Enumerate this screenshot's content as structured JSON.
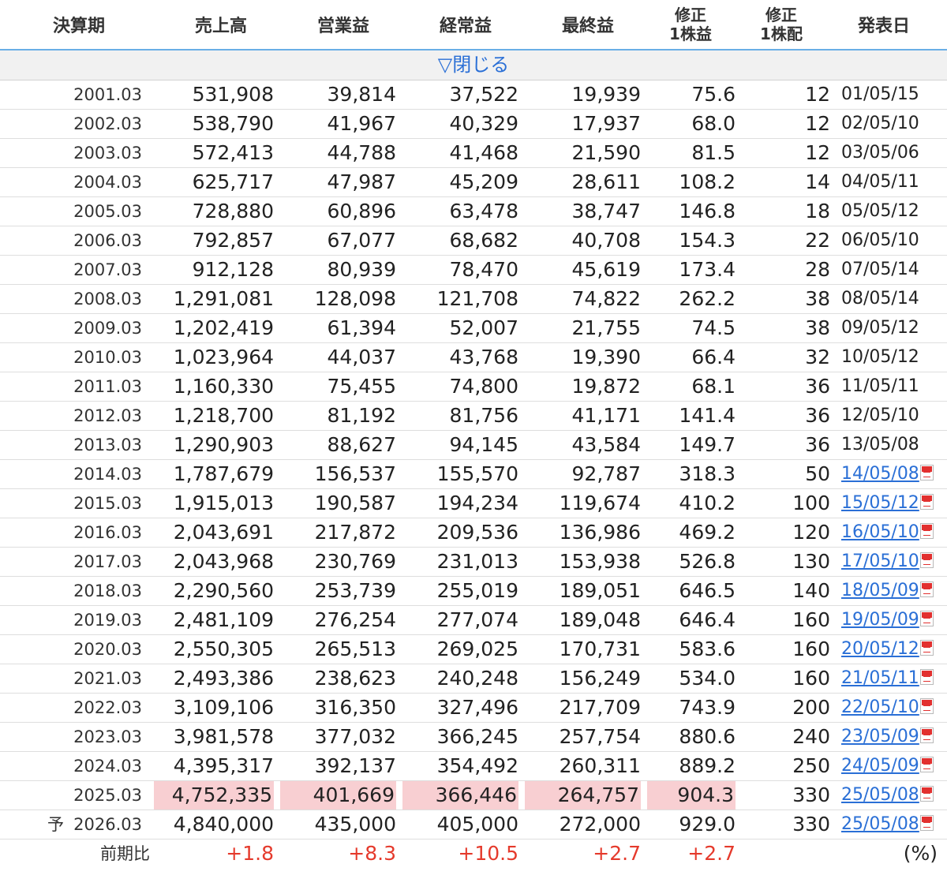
{
  "headers": {
    "period": "決算期",
    "sales": "売上高",
    "operating": "営業益",
    "ordinary": "経常益",
    "net": "最終益",
    "eps_line1": "修正",
    "eps_line2": "1株益",
    "dps_line1": "修正",
    "dps_line2": "1株配",
    "date": "発表日"
  },
  "toggle_label": "▽閉じる",
  "rows": [
    {
      "period": "2001.03",
      "sales": "531,908",
      "operating": "39,814",
      "ordinary": "37,522",
      "net": "19,939",
      "eps": "75.6",
      "dps": "12",
      "date": "01/05/15"
    },
    {
      "period": "2002.03",
      "sales": "538,790",
      "operating": "41,967",
      "ordinary": "40,329",
      "net": "17,937",
      "eps": "68.0",
      "dps": "12",
      "date": "02/05/10"
    },
    {
      "period": "2003.03",
      "sales": "572,413",
      "operating": "44,788",
      "ordinary": "41,468",
      "net": "21,590",
      "eps": "81.5",
      "dps": "12",
      "date": "03/05/06"
    },
    {
      "period": "2004.03",
      "sales": "625,717",
      "operating": "47,987",
      "ordinary": "45,209",
      "net": "28,611",
      "eps": "108.2",
      "dps": "14",
      "date": "04/05/11"
    },
    {
      "period": "2005.03",
      "sales": "728,880",
      "operating": "60,896",
      "ordinary": "63,478",
      "net": "38,747",
      "eps": "146.8",
      "dps": "18",
      "date": "05/05/12"
    },
    {
      "period": "2006.03",
      "sales": "792,857",
      "operating": "67,077",
      "ordinary": "68,682",
      "net": "40,708",
      "eps": "154.3",
      "dps": "22",
      "date": "06/05/10"
    },
    {
      "period": "2007.03",
      "sales": "912,128",
      "operating": "80,939",
      "ordinary": "78,470",
      "net": "45,619",
      "eps": "173.4",
      "dps": "28",
      "date": "07/05/14"
    },
    {
      "period": "2008.03",
      "sales": "1,291,081",
      "operating": "128,098",
      "ordinary": "121,708",
      "net": "74,822",
      "eps": "262.2",
      "dps": "38",
      "date": "08/05/14"
    },
    {
      "period": "2009.03",
      "sales": "1,202,419",
      "operating": "61,394",
      "ordinary": "52,007",
      "net": "21,755",
      "eps": "74.5",
      "dps": "38",
      "date": "09/05/12"
    },
    {
      "period": "2010.03",
      "sales": "1,023,964",
      "operating": "44,037",
      "ordinary": "43,768",
      "net": "19,390",
      "eps": "66.4",
      "dps": "32",
      "date": "10/05/12"
    },
    {
      "period": "2011.03",
      "sales": "1,160,330",
      "operating": "75,455",
      "ordinary": "74,800",
      "net": "19,872",
      "eps": "68.1",
      "dps": "36",
      "date": "11/05/11"
    },
    {
      "period": "2012.03",
      "sales": "1,218,700",
      "operating": "81,192",
      "ordinary": "81,756",
      "net": "41,171",
      "eps": "141.4",
      "dps": "36",
      "date": "12/05/10"
    },
    {
      "period": "2013.03",
      "sales": "1,290,903",
      "operating": "88,627",
      "ordinary": "94,145",
      "net": "43,584",
      "eps": "149.7",
      "dps": "36",
      "date": "13/05/08"
    },
    {
      "period": "2014.03",
      "sales": "1,787,679",
      "operating": "156,537",
      "ordinary": "155,570",
      "net": "92,787",
      "eps": "318.3",
      "dps": "50",
      "date": "14/05/08"
    },
    {
      "period": "2015.03",
      "sales": "1,915,013",
      "operating": "190,587",
      "ordinary": "194,234",
      "net": "119,674",
      "eps": "410.2",
      "dps": "100",
      "date": "15/05/12"
    },
    {
      "period": "2016.03",
      "sales": "2,043,691",
      "operating": "217,872",
      "ordinary": "209,536",
      "net": "136,986",
      "eps": "469.2",
      "dps": "120",
      "date": "16/05/10"
    },
    {
      "period": "2017.03",
      "sales": "2,043,968",
      "operating": "230,769",
      "ordinary": "231,013",
      "net": "153,938",
      "eps": "526.8",
      "dps": "130",
      "date": "17/05/10"
    },
    {
      "period": "2018.03",
      "sales": "2,290,560",
      "operating": "253,739",
      "ordinary": "255,019",
      "net": "189,051",
      "eps": "646.5",
      "dps": "140",
      "date": "18/05/09"
    },
    {
      "period": "2019.03",
      "sales": "2,481,109",
      "operating": "276,254",
      "ordinary": "277,074",
      "net": "189,048",
      "eps": "646.4",
      "dps": "160",
      "date": "19/05/09"
    },
    {
      "period": "2020.03",
      "sales": "2,550,305",
      "operating": "265,513",
      "ordinary": "269,025",
      "net": "170,731",
      "eps": "583.6",
      "dps": "160",
      "date": "20/05/12"
    },
    {
      "period": "2021.03",
      "sales": "2,493,386",
      "operating": "238,623",
      "ordinary": "240,248",
      "net": "156,249",
      "eps": "534.0",
      "dps": "160",
      "date": "21/05/11"
    },
    {
      "period": "2022.03",
      "sales": "3,109,106",
      "operating": "316,350",
      "ordinary": "327,496",
      "net": "217,709",
      "eps": "743.9",
      "dps": "200",
      "date": "22/05/10"
    },
    {
      "period": "2023.03",
      "sales": "3,981,578",
      "operating": "377,032",
      "ordinary": "366,245",
      "net": "257,754",
      "eps": "880.6",
      "dps": "240",
      "date": "23/05/09"
    },
    {
      "period": "2024.03",
      "sales": "4,395,317",
      "operating": "392,137",
      "ordinary": "354,492",
      "net": "260,311",
      "eps": "889.2",
      "dps": "250",
      "date": "24/05/09"
    },
    {
      "period": "2025.03",
      "sales": "4,752,335",
      "operating": "401,669",
      "ordinary": "366,446",
      "net": "264,757",
      "eps": "904.3",
      "dps": "330",
      "date": "25/05/08"
    },
    {
      "period": "2026.03",
      "sales": "4,840,000",
      "operating": "435,000",
      "ordinary": "405,000",
      "net": "272,000",
      "eps": "929.0",
      "dps": "330",
      "date": "25/05/08"
    }
  ],
  "forecast_mark": "予",
  "ratio": {
    "label": "前期比",
    "sales": "+1.8",
    "operating": "+8.3",
    "ordinary": "+10.5",
    "net": "+2.7",
    "eps": "+2.7",
    "unit": "(%)"
  },
  "colors": {
    "link": "#2a6fd6",
    "positive": "#e53a2c",
    "highlight": "#f8cfd2",
    "header_rule": "#6aaee6"
  },
  "icons": {
    "document": "pdf-icon"
  }
}
